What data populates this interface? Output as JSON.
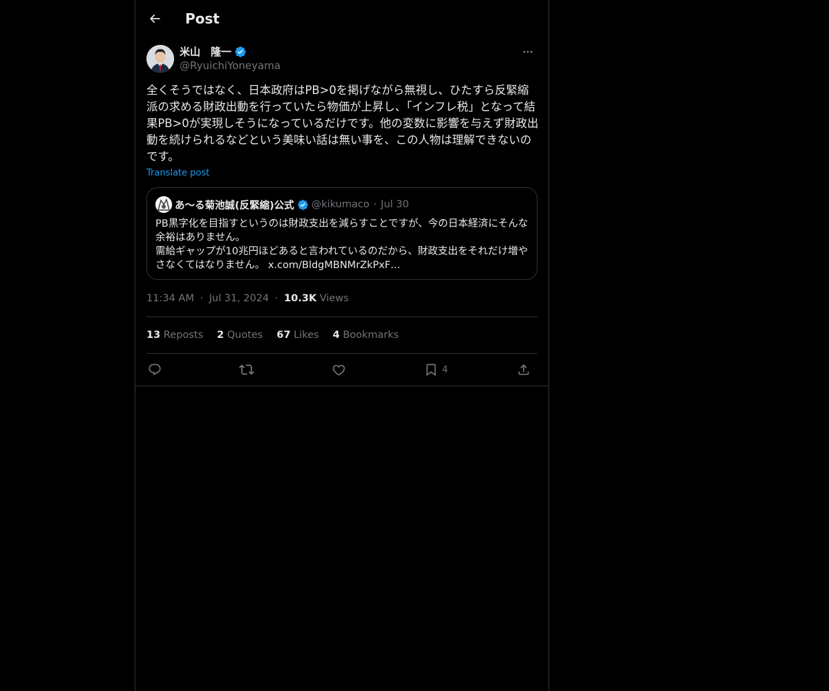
{
  "header": {
    "title": "Post"
  },
  "author": {
    "name": "米山　隆一",
    "handle": "@RyuichiYoneyama"
  },
  "post": {
    "text": "全くそうではなく、日本政府はPB>0を掲げながら無視し、ひたすら反緊縮派の求める財政出動を行っていたら物価が上昇し、「インフレ税」となって結果PB>0が実現しそうになっているだけです。他の変数に影響を与えず財政出動を続けられるなどという美味い話は無い事を、この人物は理解できないのです。",
    "translate_label": "Translate post"
  },
  "quote": {
    "name": "あ〜る菊池誠(反緊縮)公式",
    "handle": "@kikumaco",
    "separator": "·",
    "date": "Jul 30",
    "text": "PB黒字化を目指すというのは財政支出を減らすことですが、今の日本経済にそんな余裕はありません。\n需給ギャップが10兆円ほどあると言われているのだから、財政支出をそれだけ増やさなくてはなりません。 x.com/BldgMBNMrZkPxF…"
  },
  "meta": {
    "time": "11:34 AM",
    "sep1": "·",
    "date": "Jul 31, 2024",
    "sep2": "·",
    "views_count": "10.3K",
    "views_label": "Views"
  },
  "stats": {
    "reposts_count": "13",
    "reposts_label": "Reposts",
    "quotes_count": "2",
    "quotes_label": "Quotes",
    "likes_count": "67",
    "likes_label": "Likes",
    "bookmarks_count": "4",
    "bookmarks_label": "Bookmarks"
  },
  "actions": {
    "bookmark_count": "4"
  },
  "colors": {
    "background": "#000000",
    "text": "#e7e9ea",
    "secondary": "#71767b",
    "accent": "#1d9bf0",
    "border": "#2f3336"
  },
  "icons": {
    "back": "arrow-left-icon",
    "more": "more-horizontal-icon",
    "verified": "verified-badge-icon",
    "reply": "reply-icon",
    "repost": "repost-icon",
    "like": "heart-icon",
    "bookmark": "bookmark-icon",
    "share": "share-icon"
  }
}
